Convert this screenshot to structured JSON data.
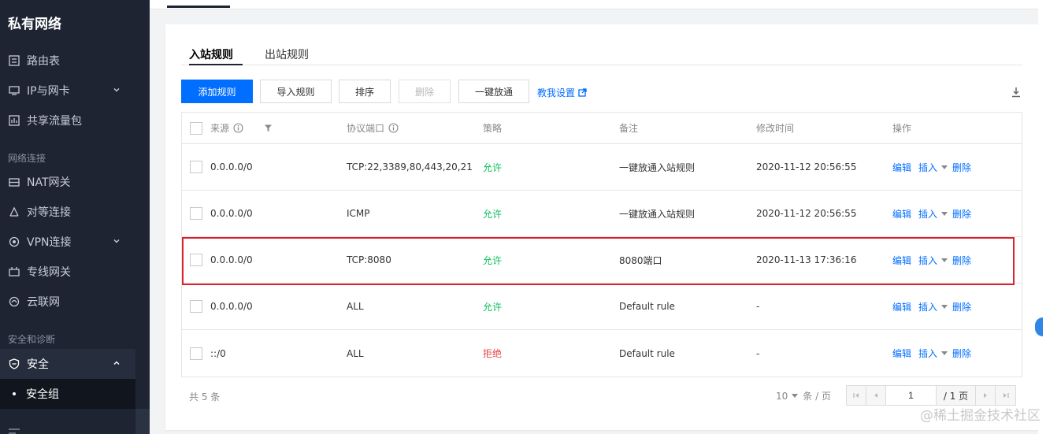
{
  "sidebar": {
    "title": "私有网络",
    "items_top": [
      {
        "label": "路由表",
        "icon": "route-table-icon"
      },
      {
        "label": "IP与网卡",
        "icon": "network-card-icon",
        "expandable": true
      },
      {
        "label": "共享流量包",
        "icon": "traffic-package-icon"
      }
    ],
    "group_network": "网络连接",
    "items_network": [
      {
        "label": "NAT网关",
        "icon": "nat-gateway-icon"
      },
      {
        "label": "对等连接",
        "icon": "peering-icon"
      },
      {
        "label": "VPN连接",
        "icon": "vpn-icon",
        "expandable": true
      },
      {
        "label": "专线网关",
        "icon": "direct-connect-icon"
      },
      {
        "label": "云联网",
        "icon": "ccn-icon"
      }
    ],
    "group_security": "安全和诊断",
    "security": {
      "label": "安全",
      "icon": "shield-icon",
      "expanded": true
    },
    "security_sub": {
      "label": "安全组"
    }
  },
  "tabs": {
    "inbound": "入站规则",
    "outbound": "出站规则"
  },
  "toolbar": {
    "add": "添加规则",
    "import": "导入规则",
    "sort": "排序",
    "delete": "删除",
    "open_all": "一键放通",
    "help": "教我设置"
  },
  "table": {
    "columns": [
      "来源",
      "协议端口",
      "策略",
      "备注",
      "修改时间",
      "操作"
    ],
    "rows": [
      {
        "source": "0.0.0.0/0",
        "port": "TCP:22,3389,80,443,20,21",
        "policy": "允许",
        "policy_type": "allow",
        "note": "一键放通入站规则",
        "time": "2020-11-12 20:56:55"
      },
      {
        "source": "0.0.0.0/0",
        "port": "ICMP",
        "policy": "允许",
        "policy_type": "allow",
        "note": "一键放通入站规则",
        "time": "2020-11-12 20:56:55"
      },
      {
        "source": "0.0.0.0/0",
        "port": "TCP:8080",
        "policy": "允许",
        "policy_type": "allow",
        "note": "8080端口",
        "time": "2020-11-13 17:36:16",
        "highlighted": true
      },
      {
        "source": "0.0.0.0/0",
        "port": "ALL",
        "policy": "允许",
        "policy_type": "allow",
        "note": "Default rule",
        "time": "-"
      },
      {
        "source": "::/0",
        "port": "ALL",
        "policy": "拒绝",
        "policy_type": "deny",
        "note": "Default rule",
        "time": "-"
      }
    ],
    "actions": {
      "edit": "编辑",
      "insert": "插入",
      "delete": "删除"
    }
  },
  "footer": {
    "total": "共 5 条",
    "page_size": "10",
    "page_size_unit": "条 / 页",
    "page_input": "1",
    "page_total": "/ 1 页"
  },
  "watermark": "@稀土掘金技术社区",
  "colors": {
    "primary": "#006eff",
    "allow": "#0abf5b",
    "deny": "#e54545",
    "sidebar_bg": "#1e2432",
    "highlight_border": "#d9232d"
  }
}
